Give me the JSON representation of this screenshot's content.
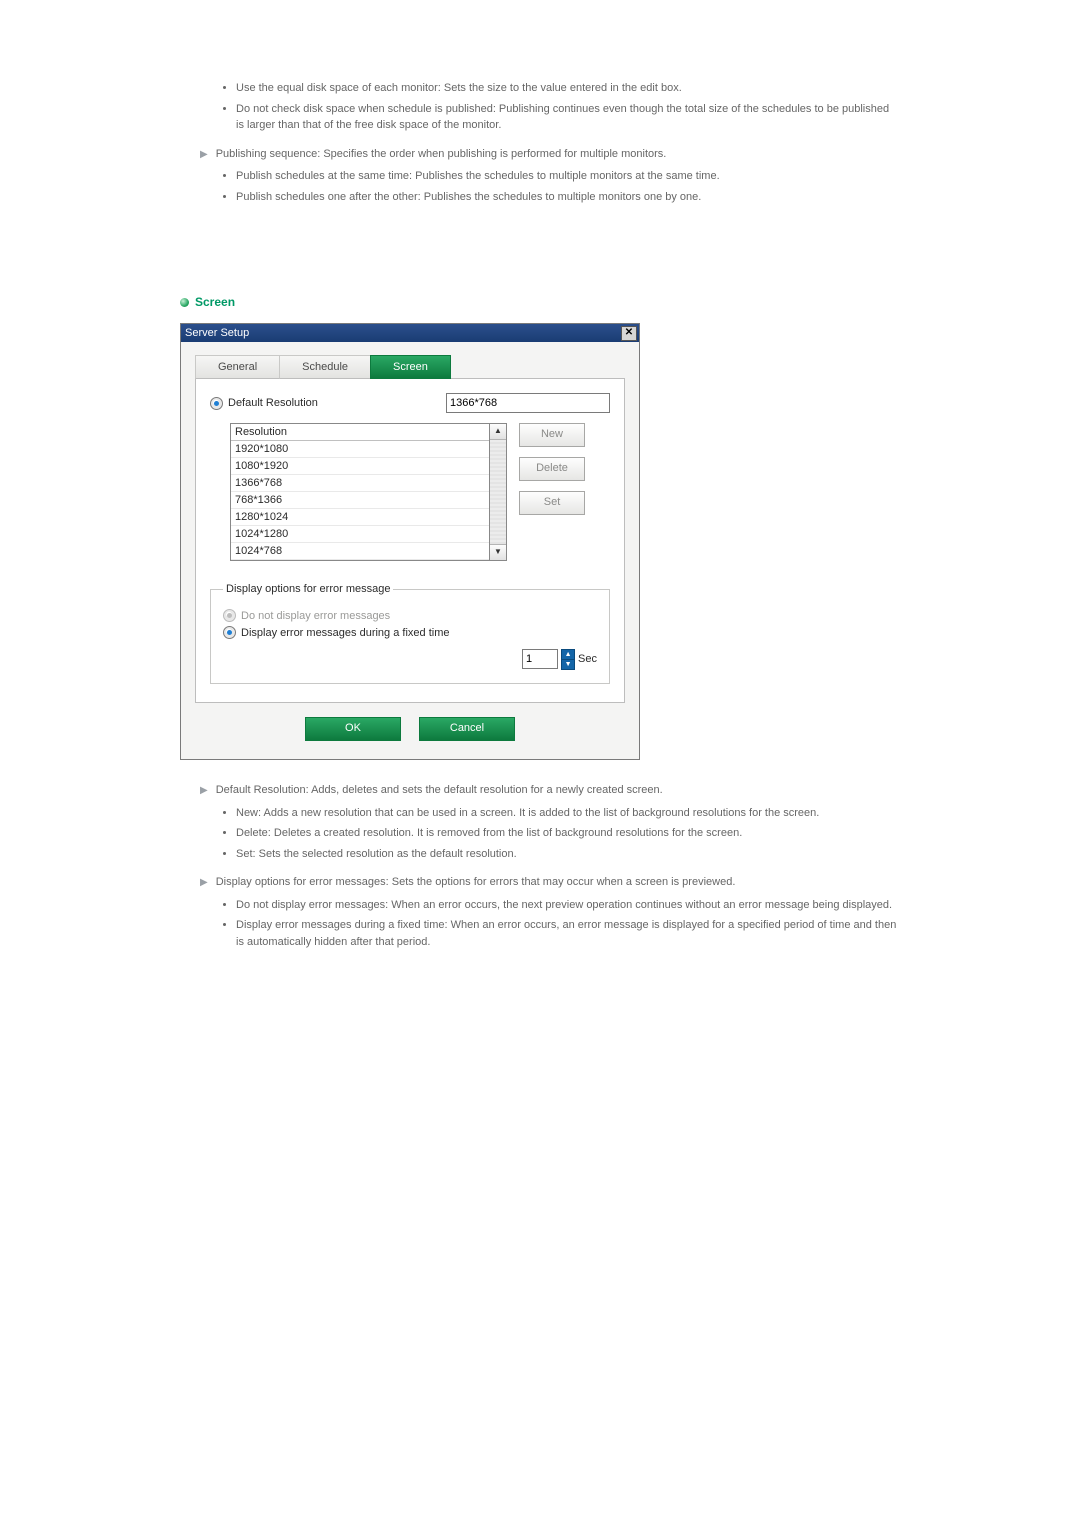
{
  "intro": {
    "bullets": [
      "Use the equal disk space of each monitor: Sets the size to the value entered in the edit box.",
      "Do not check disk space when schedule is published: Publishing continues even though the total size of the schedules to be published is larger than that of the free disk space of the monitor."
    ],
    "publishing_sequence": "Publishing sequence: Specifies the order when publishing is performed for multiple monitors.",
    "publishing_bullets": [
      "Publish schedules at the same time: Publishes the schedules to multiple monitors at the same time.",
      "Publish schedules one after the other: Publishes the schedules to multiple monitors one by one."
    ]
  },
  "section_heading": "Screen",
  "dialog": {
    "title": "Server Setup",
    "tabs": {
      "general": "General",
      "schedule": "Schedule",
      "screen": "Screen"
    },
    "default_resolution_label": "Default Resolution",
    "default_resolution_value": "1366*768",
    "list_header": "Resolution",
    "resolutions": [
      "1920*1080",
      "1080*1920",
      "1366*768",
      "768*1366",
      "1280*1024",
      "1024*1280",
      "1024*768"
    ],
    "buttons": {
      "new": "New",
      "delete": "Delete",
      "set": "Set"
    },
    "error_group_label": "Display options for error message",
    "opt_no_display": "Do not display error messages",
    "opt_display_fixed": "Display error messages during a fixed time",
    "sec_value": "1",
    "sec_label": "Sec",
    "ok": "OK",
    "cancel": "Cancel"
  },
  "explain": {
    "default_res": "Default Resolution: Adds, deletes and sets the default resolution for a newly created screen.",
    "default_res_bullets": [
      "New: Adds a new resolution that can be used in a screen. It is added to the list of background resolutions for the screen.",
      "Delete: Deletes a created resolution. It is removed from the list of background resolutions for the screen.",
      "Set: Sets the selected resolution as the default resolution."
    ],
    "display_opts": "Display options for error messages: Sets the options for errors that may occur when a screen is previewed.",
    "display_opts_bullets": [
      "Do not display error messages: When an error occurs, the next preview operation continues without an error message being displayed.",
      "Display error messages during a fixed time: When an error occurs, an error message is displayed for a specified period of time and then is automatically hidden after that period."
    ]
  }
}
